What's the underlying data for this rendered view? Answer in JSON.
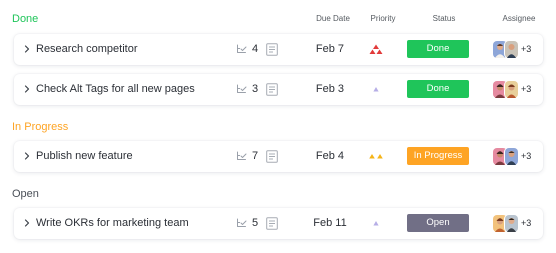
{
  "colors": {
    "done_green": "#1fc55a",
    "in_progress_orange": "#fea424",
    "open_gray": "#716f86",
    "priority_high_red": "#e23a3a",
    "priority_medium_yellow": "#f5b418",
    "priority_low_purple": "#b6aee6"
  },
  "columns": {
    "due_date": "Due Date",
    "priority": "Priority",
    "status": "Status",
    "assignee": "Assignee"
  },
  "groups": [
    {
      "label": "Done",
      "tasks": [
        {
          "name": "Research competitor",
          "subtasks": "4",
          "due": "Feb 7",
          "priority": "high",
          "status": "Done",
          "extra_assignees": "+3"
        },
        {
          "name": "Check Alt Tags for all new pages",
          "subtasks": "3",
          "due": "Feb 3",
          "priority": "low",
          "status": "Done",
          "extra_assignees": "+3"
        }
      ]
    },
    {
      "label": "In Progress",
      "tasks": [
        {
          "name": "Publish new feature",
          "subtasks": "7",
          "due": "Feb 4",
          "priority": "medium",
          "status": "In Progress",
          "extra_assignees": "+3"
        }
      ]
    },
    {
      "label": "Open",
      "tasks": [
        {
          "name": "Write OKRs for marketing team",
          "subtasks": "5",
          "due": "Feb 11",
          "priority": "low",
          "status": "Open",
          "extra_assignees": "+3"
        }
      ]
    }
  ]
}
